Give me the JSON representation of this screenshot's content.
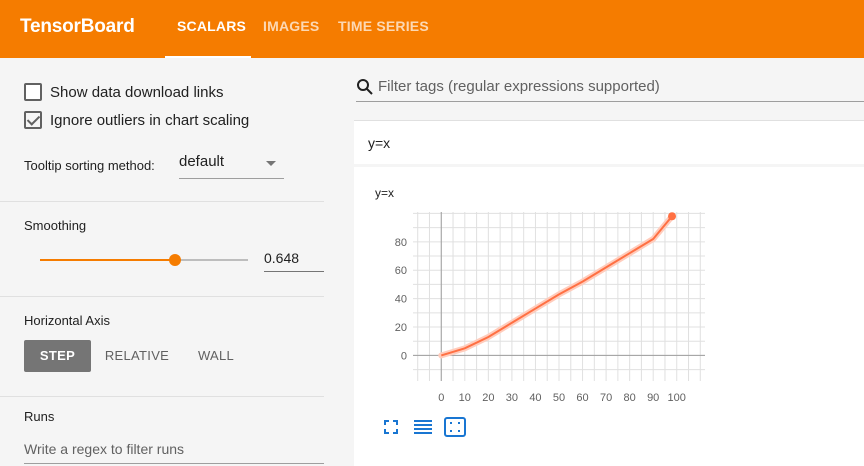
{
  "header": {
    "brand": "TensorBoard",
    "tabs": [
      {
        "label": "SCALARS",
        "active": true
      },
      {
        "label": "IMAGES",
        "active": false
      },
      {
        "label": "TIME SERIES",
        "active": false
      }
    ],
    "bg_color": "#f57c00"
  },
  "sidebar": {
    "show_download_links": {
      "label": "Show data download links",
      "checked": false
    },
    "ignore_outliers": {
      "label": "Ignore outliers in chart scaling",
      "checked": true
    },
    "tooltip_sorting": {
      "label": "Tooltip sorting method:",
      "value": "default"
    },
    "smoothing": {
      "label": "Smoothing",
      "value": "0.648",
      "fraction": 0.648
    },
    "horizontal_axis": {
      "label": "Horizontal Axis",
      "options": [
        "STEP",
        "RELATIVE",
        "WALL"
      ],
      "selected": "STEP"
    },
    "runs": {
      "label": "Runs",
      "filter_placeholder": "Write a regex to filter runs"
    }
  },
  "main": {
    "search_placeholder": "Filter tags (regular expressions supported)",
    "group_name": "y=x",
    "card": {
      "title": "y=x",
      "toolbar_icons": [
        "fullscreen-icon",
        "data-table-icon",
        "fit-domain-icon"
      ]
    }
  },
  "chart_data": {
    "type": "line",
    "title": "y=x",
    "x_ticks": [
      0,
      10,
      20,
      30,
      40,
      50,
      60,
      70,
      80,
      90,
      100
    ],
    "y_ticks": [
      0,
      20,
      40,
      60,
      80
    ],
    "xlim": [
      -12,
      112
    ],
    "ylim": [
      -18,
      101
    ],
    "grid": true,
    "series": [
      {
        "x": [
          0,
          10,
          20,
          30,
          40,
          50,
          60,
          70,
          80,
          90,
          98
        ],
        "y": [
          0,
          5,
          13,
          23,
          33,
          43,
          52,
          62,
          72,
          82,
          98
        ],
        "color": "#ff7043"
      }
    ]
  }
}
